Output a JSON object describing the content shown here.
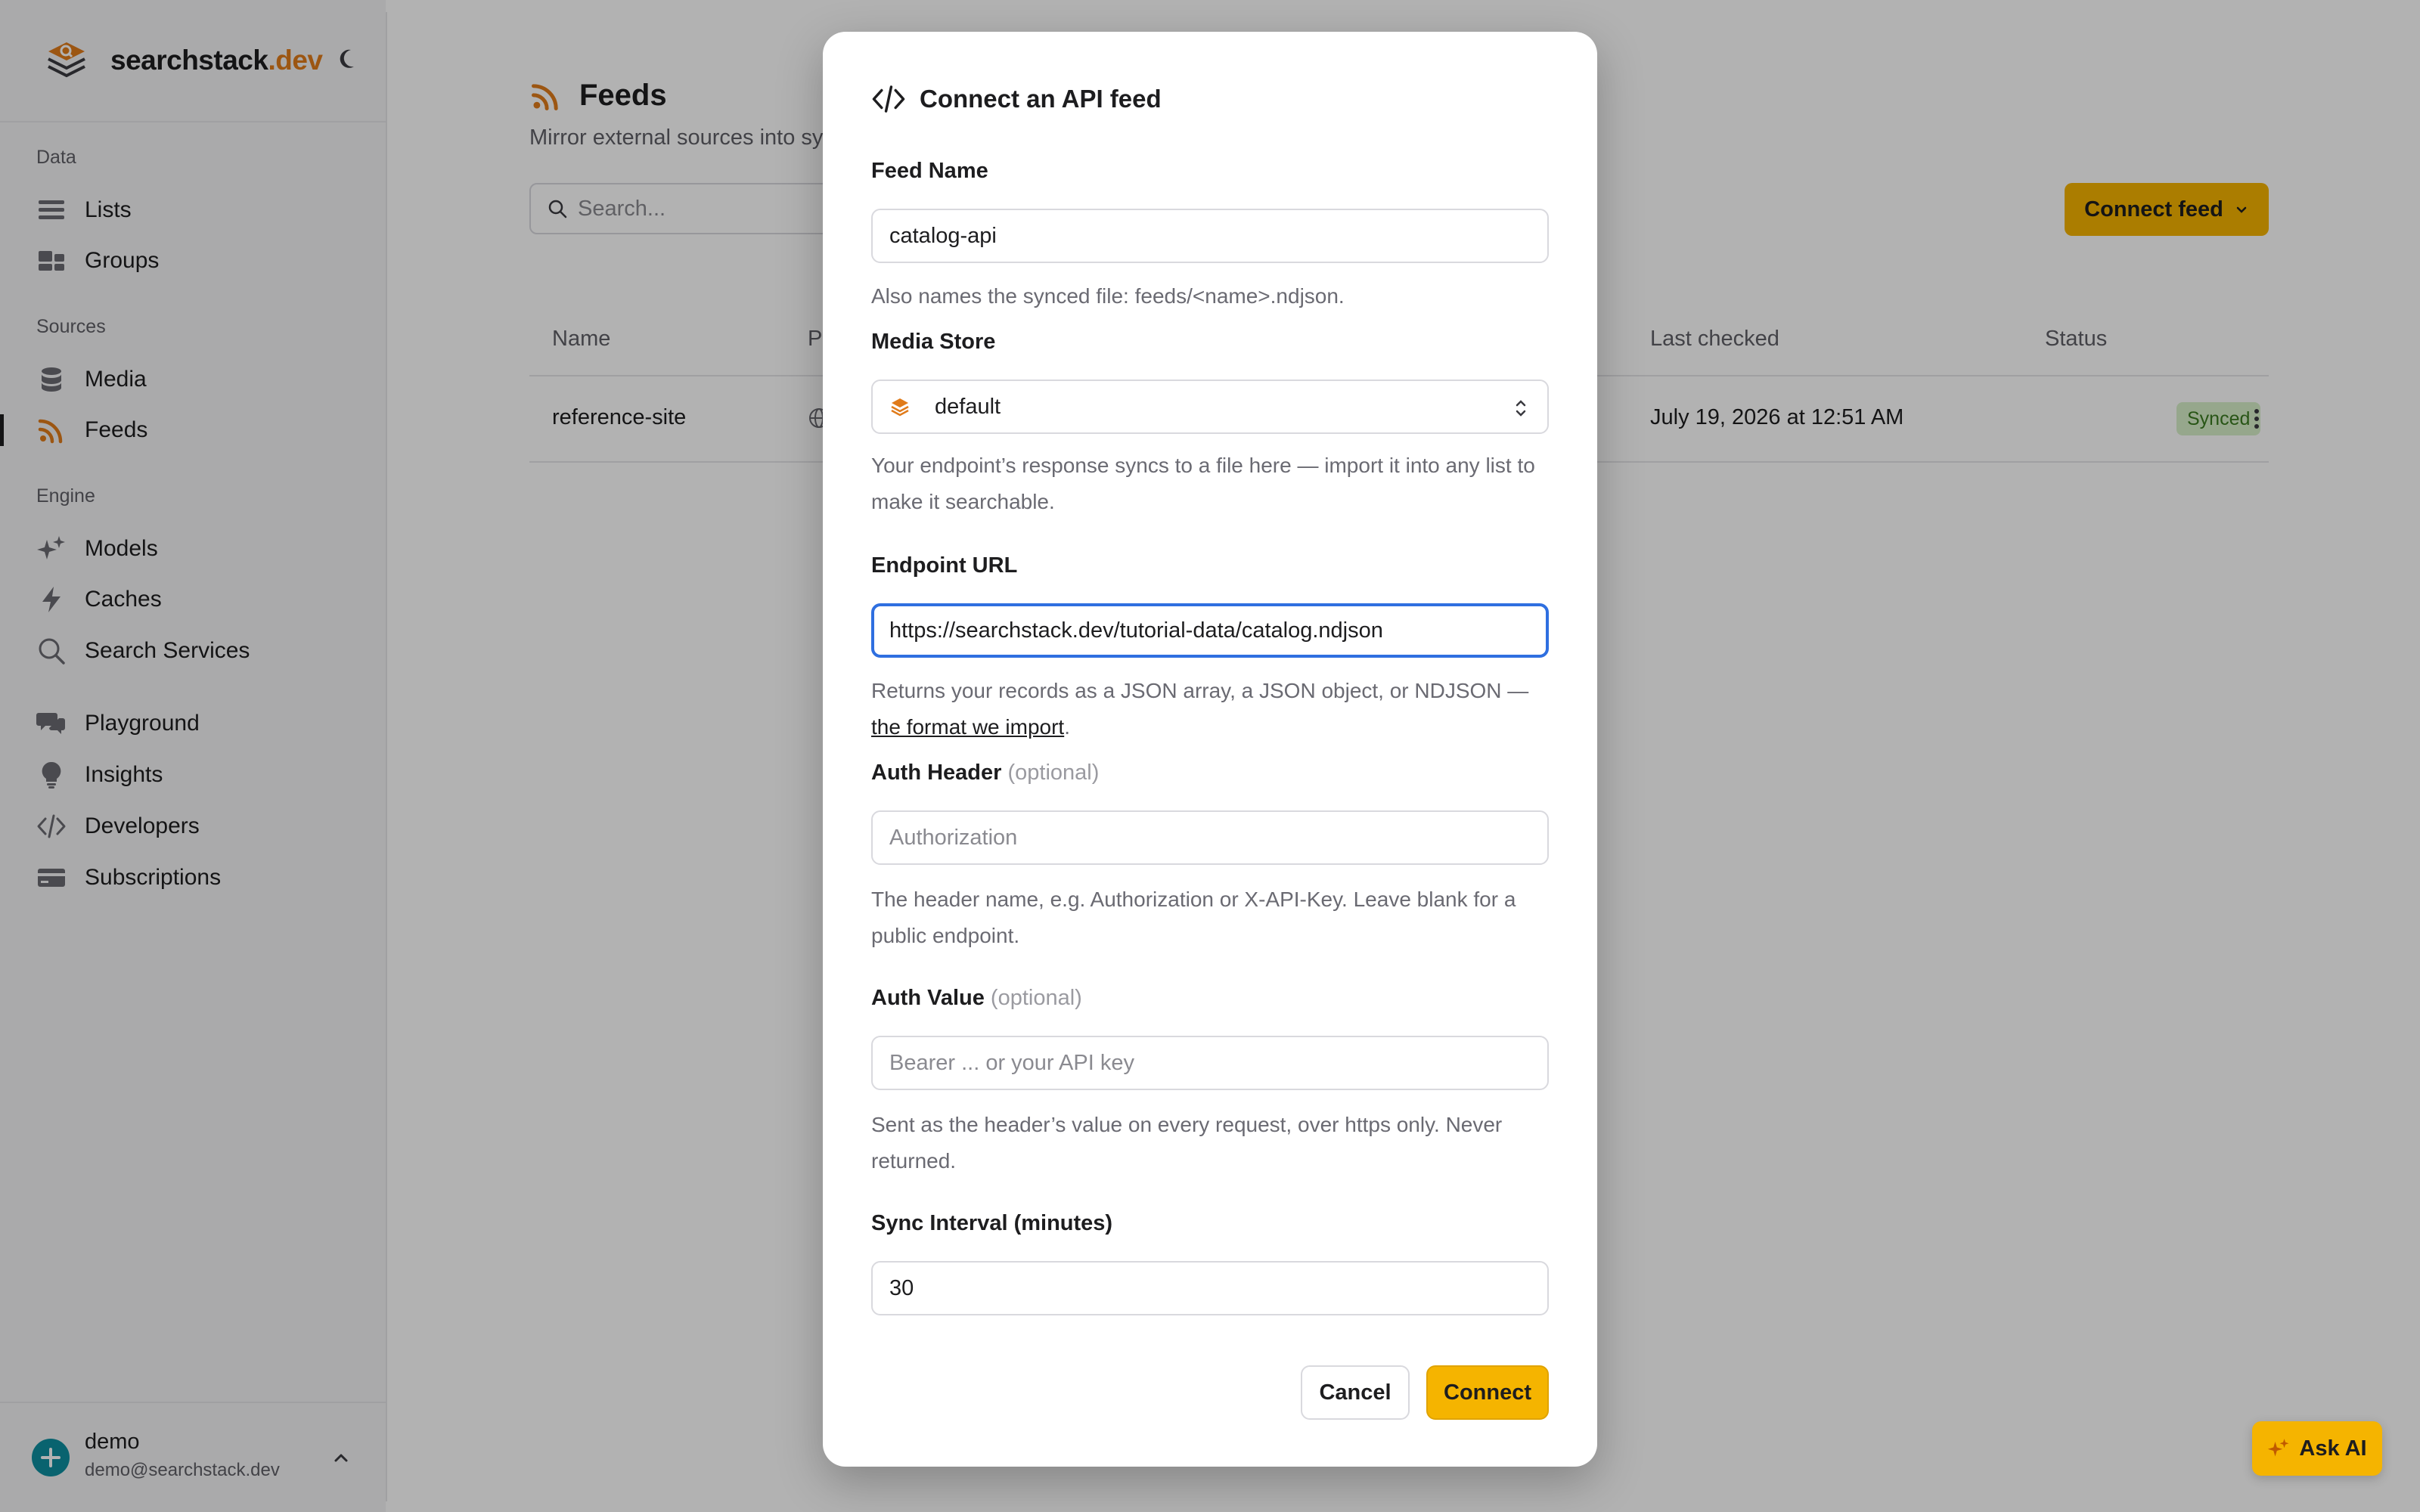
{
  "brand": {
    "name": "searchstack",
    "tld": ".dev"
  },
  "sidebar": {
    "sections": {
      "data": "Data",
      "sources": "Sources",
      "engine": "Engine"
    },
    "items": {
      "lists": "Lists",
      "groups": "Groups",
      "media": "Media",
      "feeds": "Feeds",
      "models": "Models",
      "caches": "Caches",
      "search_services": "Search Services",
      "playground": "Playground",
      "insights": "Insights",
      "developers": "Developers",
      "subscriptions": "Subscriptions"
    },
    "active_item": "Feeds",
    "user": {
      "name": "demo",
      "email": "demo@searchstack.dev"
    }
  },
  "page": {
    "title": "Feeds",
    "subtitle": "Mirror external sources into sy",
    "search_placeholder": "Search...",
    "connect_button": "Connect feed",
    "table": {
      "columns": {
        "name": "Name",
        "provider": "Pr",
        "last_checked": "Last checked",
        "status": "Status"
      },
      "rows": [
        {
          "name": "reference-site",
          "last_checked": "July 19, 2026 at 12:51 AM",
          "status": "Synced"
        }
      ]
    }
  },
  "modal": {
    "title": "Connect an API feed",
    "feed_name": {
      "label": "Feed Name",
      "value": "catalog-api",
      "help": "Also names the synced file: feeds/<name>.ndjson."
    },
    "media_store": {
      "label": "Media Store",
      "value": "default",
      "help": "Your endpoint’s response syncs to a file here — import it into any list to make it searchable."
    },
    "endpoint_url": {
      "label": "Endpoint URL",
      "value": "https://searchstack.dev/tutorial-data/catalog.ndjson",
      "help_prefix": "Returns your records as a JSON array, a JSON object, or NDJSON — ",
      "help_link": "the format we import",
      "help_suffix": "."
    },
    "auth_header": {
      "label": "Auth Header",
      "optional": "(optional)",
      "placeholder": "Authorization",
      "help": "The header name, e.g. Authorization or X-API-Key. Leave blank for a public endpoint."
    },
    "auth_value": {
      "label": "Auth Value",
      "optional": "(optional)",
      "placeholder": "Bearer ... or your API key",
      "help": "Sent as the header’s value on every request, over https only. Never returned."
    },
    "sync_interval": {
      "label": "Sync Interval (minutes)",
      "value": "30"
    },
    "cancel_button": "Cancel",
    "connect_button": "Connect"
  },
  "ask_ai": "Ask AI",
  "colors": {
    "accent": "#f5b400",
    "brand_orange": "#e07b1a",
    "focus_blue": "#2f6fe0",
    "synced_bg": "#d7f0c9",
    "synced_text": "#3a7a20"
  },
  "icons": {
    "brand": "searchstack-logo-icon",
    "theme": "moon-icon",
    "lists": "list-icon",
    "groups": "groups-icon",
    "media": "database-icon",
    "feeds": "rss-icon",
    "models": "sparkles-icon",
    "caches": "bolt-icon",
    "search_services": "search-icon",
    "playground": "chat-bubbles-icon",
    "insights": "lightbulb-icon",
    "developers": "code-icon",
    "subscriptions": "credit-card-icon"
  }
}
